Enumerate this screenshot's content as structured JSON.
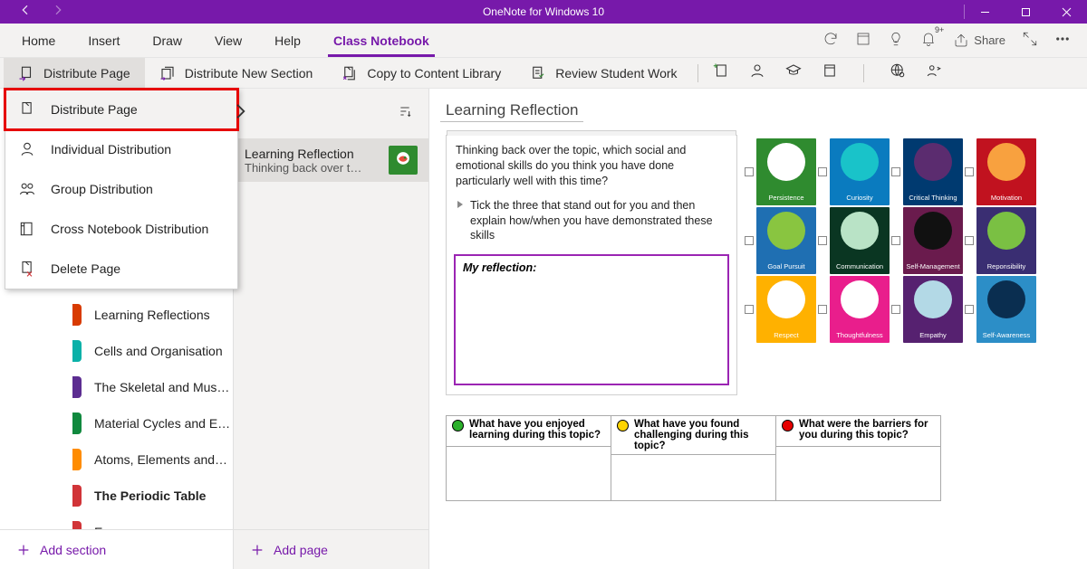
{
  "titlebar": {
    "title": "OneNote for Windows 10"
  },
  "tabs": [
    "Home",
    "Insert",
    "Draw",
    "View",
    "Help",
    "Class Notebook"
  ],
  "active_tab_index": 5,
  "tabs_right": {
    "share": "Share",
    "bell_badge": "9+"
  },
  "cmds": {
    "distribute_page": "Distribute Page",
    "distribute_section": "Distribute New Section",
    "copy_library": "Copy to Content Library",
    "review_work": "Review Student Work"
  },
  "dropdown": [
    {
      "label": "Distribute Page"
    },
    {
      "label": "Individual Distribution"
    },
    {
      "label": "Group Distribution"
    },
    {
      "label": "Cross Notebook Distribution"
    },
    {
      "label": "Delete Page"
    }
  ],
  "sections": [
    {
      "label": "Learning Reflections",
      "color": "#D83B01"
    },
    {
      "label": "Cells and Organisation",
      "color": "#0AB1A8"
    },
    {
      "label": "The Skeletal and Mus…",
      "color": "#5C2D91"
    },
    {
      "label": "Material Cycles and E…",
      "color": "#10893E"
    },
    {
      "label": "Atoms, Elements and…",
      "color": "#FF8C00"
    },
    {
      "label": "The Periodic Table",
      "color": "#D13438",
      "bold": true
    },
    {
      "label": "Energy",
      "color": "#D13438"
    }
  ],
  "add_section": "Add section",
  "add_page": "Add page",
  "page_list": {
    "title": "Learning Reflection",
    "subtitle": "Thinking back over t…",
    "thumb_caption": "Persistence"
  },
  "canvas": {
    "title": "Learning Reflection",
    "para1": "Thinking back over the topic, which social and emotional skills do you think you have done particularly well with this time?",
    "para2": "Tick the three that stand out for you and then explain how/when you have demonstrated these skills",
    "reflect_label": "My reflection:"
  },
  "skills": [
    {
      "label": "Persistence",
      "bg": "#2F8B2F",
      "ic": "#fff"
    },
    {
      "label": "Curiosity",
      "bg": "#0A7BBF",
      "ic": "#19C3C9"
    },
    {
      "label": "Critical Thinking",
      "bg": "#003A70",
      "ic": "#5B2C6F"
    },
    {
      "label": "Motivation",
      "bg": "#C1121F",
      "ic": "#F8A13F"
    },
    {
      "label": "Goal Pursuit",
      "bg": "#1F6FB2",
      "ic": "#89C540"
    },
    {
      "label": "Communication",
      "bg": "#0A3622",
      "ic": "#B9E3C6"
    },
    {
      "label": "Self-Management",
      "bg": "#6A1B4D",
      "ic": "#111"
    },
    {
      "label": "Reponsibility",
      "bg": "#3A2E72",
      "ic": "#7AC043"
    },
    {
      "label": "Respect",
      "bg": "#FFB100",
      "ic": "#fff"
    },
    {
      "label": "Thoughtfulness",
      "bg": "#E91E8C",
      "ic": "#fff"
    },
    {
      "label": "Empathy",
      "bg": "#562170",
      "ic": "#B3D9E6"
    },
    {
      "label": "Self-Awareness",
      "bg": "#2C8EC7",
      "ic": "#0A2E50"
    }
  ],
  "enjoy": [
    {
      "q": "What have you enjoyed learning during this topic?",
      "color": "#2BB02B"
    },
    {
      "q": "What have you found challenging during this topic?",
      "color": "#FFD400"
    },
    {
      "q": "What were the barriers for you during this topic?",
      "color": "#E60000"
    }
  ]
}
